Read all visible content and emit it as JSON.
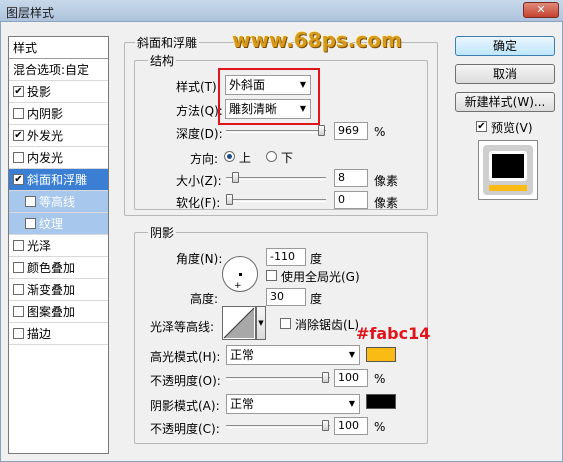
{
  "window": {
    "title": "图层样式",
    "close": "✕"
  },
  "watermark": "www.68ps.com",
  "annotation": "#fabc14",
  "colors": {
    "accent": "#3a7fd4",
    "highlight_swatch": "#fabc14",
    "shadow_swatch": "#000000",
    "annotation": "#e0151c",
    "watermark": "#d89a1c"
  },
  "sidebar": {
    "header": "样式",
    "items": [
      {
        "label": "混合选项:自定",
        "checkbox": false,
        "checked": false
      },
      {
        "label": "投影",
        "checkbox": true,
        "checked": true
      },
      {
        "label": "内阴影",
        "checkbox": true,
        "checked": false
      },
      {
        "label": "外发光",
        "checkbox": true,
        "checked": true
      },
      {
        "label": "内发光",
        "checkbox": true,
        "checked": false
      },
      {
        "label": "斜面和浮雕",
        "checkbox": true,
        "checked": true
      },
      {
        "label": "等高线",
        "checkbox": true,
        "checked": false
      },
      {
        "label": "纹理",
        "checkbox": true,
        "checked": false
      },
      {
        "label": "光泽",
        "checkbox": true,
        "checked": false
      },
      {
        "label": "颜色叠加",
        "checkbox": true,
        "checked": false
      },
      {
        "label": "渐变叠加",
        "checkbox": true,
        "checked": false
      },
      {
        "label": "图案叠加",
        "checkbox": true,
        "checked": false
      },
      {
        "label": "描边",
        "checkbox": true,
        "checked": false
      }
    ]
  },
  "bevel": {
    "group_title": "斜面和浮雕",
    "structure_title": "结构",
    "style_label": "样式(T):",
    "style_value": "外斜面",
    "method_label": "方法(Q):",
    "method_value": "雕刻清晰",
    "depth_label": "深度(D):",
    "depth_value": "969",
    "depth_unit": "%",
    "direction_label": "方向:",
    "direction_up": "上",
    "direction_down": "下",
    "size_label": "大小(Z):",
    "size_value": "8",
    "size_unit": "像素",
    "soften_label": "软化(F):",
    "soften_value": "0",
    "soften_unit": "像素"
  },
  "shading": {
    "title": "阴影",
    "angle_label": "角度(N):",
    "angle_value": "-110",
    "angle_unit": "度",
    "global_light_label": "使用全局光(G)",
    "altitude_label": "高度:",
    "altitude_value": "30",
    "altitude_unit": "度",
    "gloss_label": "光泽等高线:",
    "antialias_label": "消除锯齿(L)",
    "highlight_label": "高光模式(H):",
    "highlight_value": "正常",
    "hl_opacity_label": "不透明度(O):",
    "hl_opacity_value": "100",
    "hl_opacity_unit": "%",
    "shadow_label": "阴影模式(A):",
    "shadow_value": "正常",
    "sh_opacity_label": "不透明度(C):",
    "sh_opacity_value": "100",
    "sh_opacity_unit": "%"
  },
  "buttons": {
    "ok": "确定",
    "cancel": "取消",
    "new_style": "新建样式(W)...",
    "preview": "预览(V)"
  }
}
